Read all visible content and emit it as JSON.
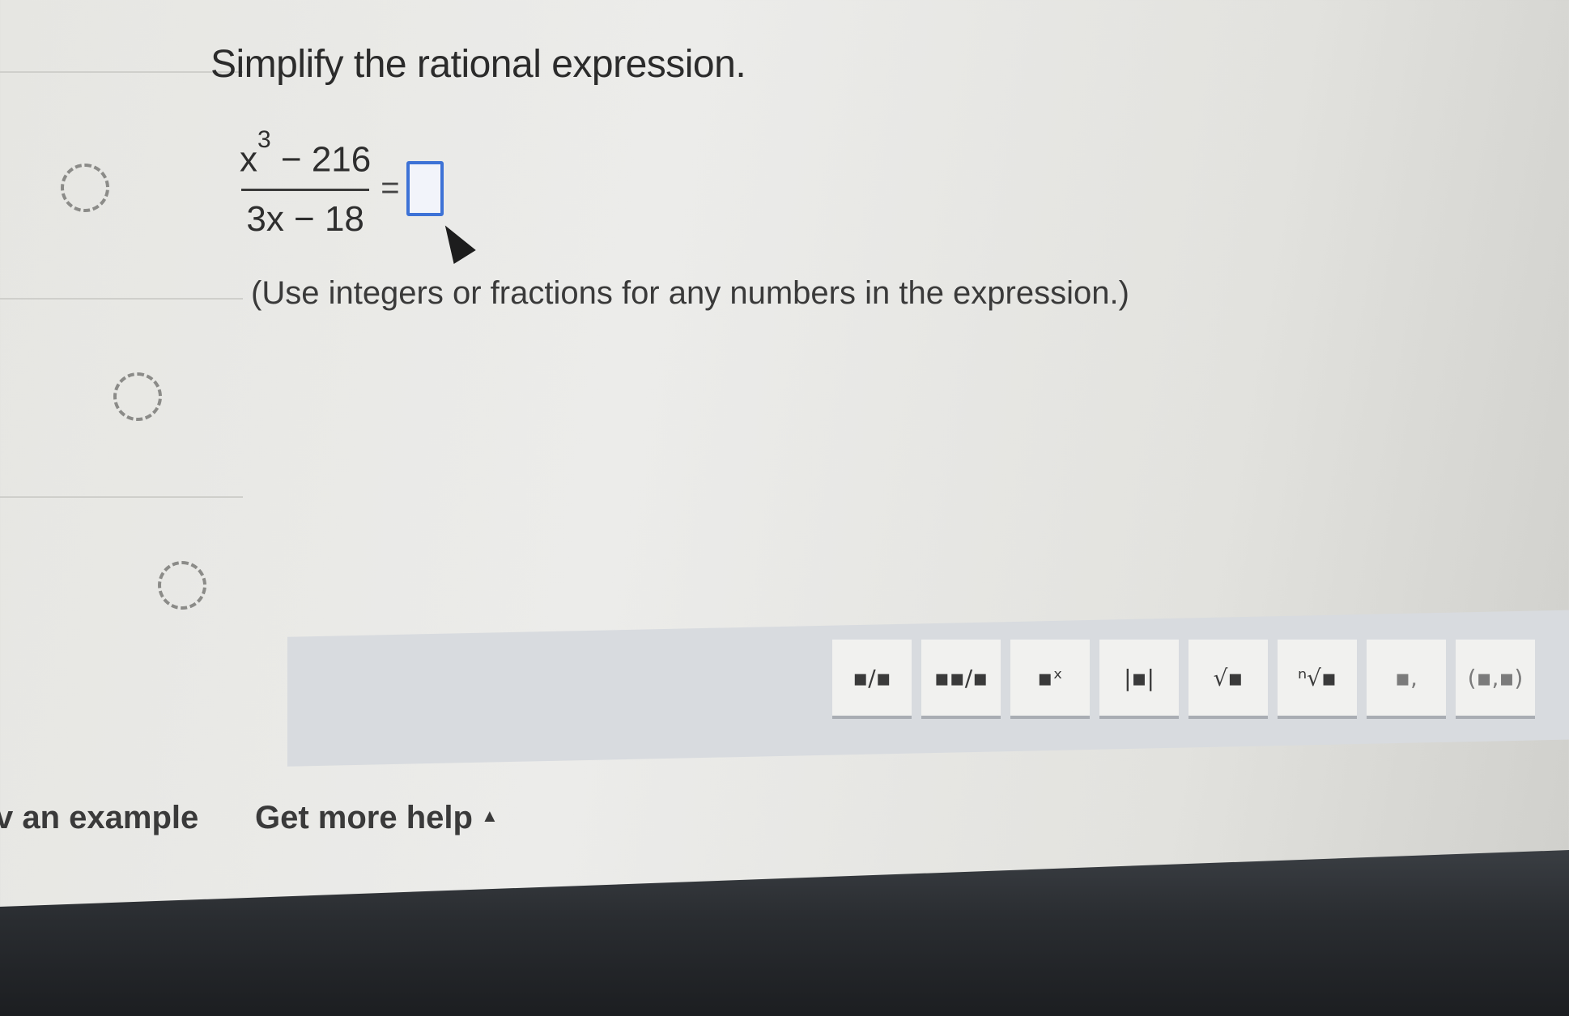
{
  "question": {
    "title": "Simplify the rational expression.",
    "numerator_base": "x",
    "numerator_exponent": "3",
    "numerator_rest": " − 216",
    "denominator": "3x − 18",
    "equals": "=",
    "instruction": "(Use integers or fractions for any numbers in the expression.)"
  },
  "toolbar": {
    "tools": [
      {
        "name": "fraction-tool",
        "glyph": "▪/▪"
      },
      {
        "name": "mixed-number-tool",
        "glyph": "▪▪/▪"
      },
      {
        "name": "exponent-tool",
        "glyph": "▪ˣ"
      },
      {
        "name": "absolute-value-tool",
        "glyph": "|▪|"
      },
      {
        "name": "square-root-tool",
        "glyph": "√▪"
      },
      {
        "name": "nth-root-tool",
        "glyph": "ⁿ√▪"
      },
      {
        "name": "decimal-tool",
        "glyph": "▪,"
      },
      {
        "name": "ordered-pair-tool",
        "glyph": "(▪,▪)"
      }
    ]
  },
  "links": {
    "example": "v an example",
    "help": "Get more help",
    "help_caret": "▲"
  }
}
